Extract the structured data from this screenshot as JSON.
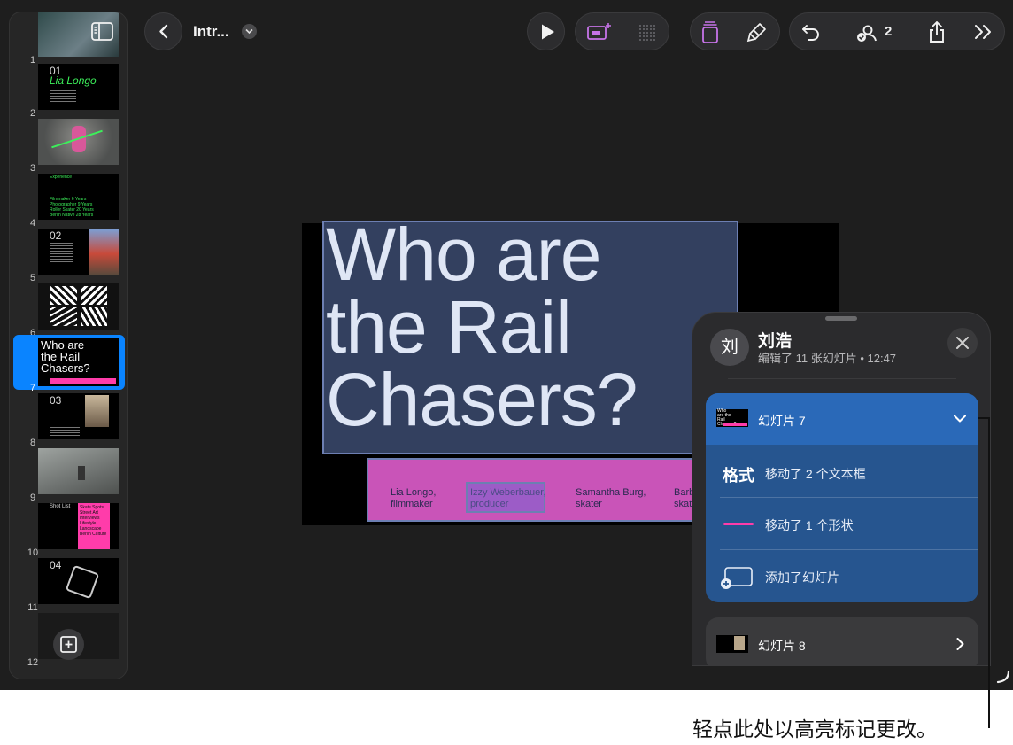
{
  "toolbar": {
    "doc_title": "Intr...",
    "collaborator_count": "2"
  },
  "sidebar": {
    "slides": [
      {
        "num": "1"
      },
      {
        "num": "2",
        "head": "01",
        "title": "Lia Longo"
      },
      {
        "num": "3"
      },
      {
        "num": "4",
        "head": "Experience",
        "rows": [
          "Filmmaker 6 Years",
          "Photographer 9 Years",
          "Roller Skater 20 Years",
          "Berlin Native 28 Years"
        ]
      },
      {
        "num": "5",
        "head": "02"
      },
      {
        "num": "6"
      },
      {
        "num": "7",
        "title": "Who are the Rail Chasers?"
      },
      {
        "num": "8",
        "head": "03"
      },
      {
        "num": "9"
      },
      {
        "num": "10",
        "head": "Shot List",
        "pink": "Skate Spots Street Art Interviews Lifestyle Landscape Berlin Culture"
      },
      {
        "num": "11",
        "head": "04"
      },
      {
        "num": "12"
      }
    ]
  },
  "slide": {
    "title_lines": [
      "Who are",
      "the Rail",
      "Chasers?"
    ],
    "names": [
      {
        "line1": "Lia Longo,",
        "line2": "filmmaker"
      },
      {
        "line1": "Izzy Weberbauer,",
        "line2": "producer"
      },
      {
        "line1": "Samantha Burg,",
        "line2": "skater"
      },
      {
        "line1": "Barb",
        "line2": "skate"
      }
    ]
  },
  "panel": {
    "avatar": "刘",
    "user_name": "刘浩",
    "subtitle": "编辑了 11 张幻灯片 • 12:47",
    "group_title": "幻灯片 7",
    "changes": [
      {
        "badge": "格式",
        "text": "移动了 2 个文本框"
      },
      {
        "text": "移动了 1 个形状"
      },
      {
        "text": "添加了幻灯片"
      }
    ],
    "next_title": "幻灯片 8"
  },
  "caption": "轻点此处以高亮标记更改。",
  "colors": {
    "accent": "#0a84ff",
    "pink": "#ff3caa",
    "group": "#26558f"
  }
}
